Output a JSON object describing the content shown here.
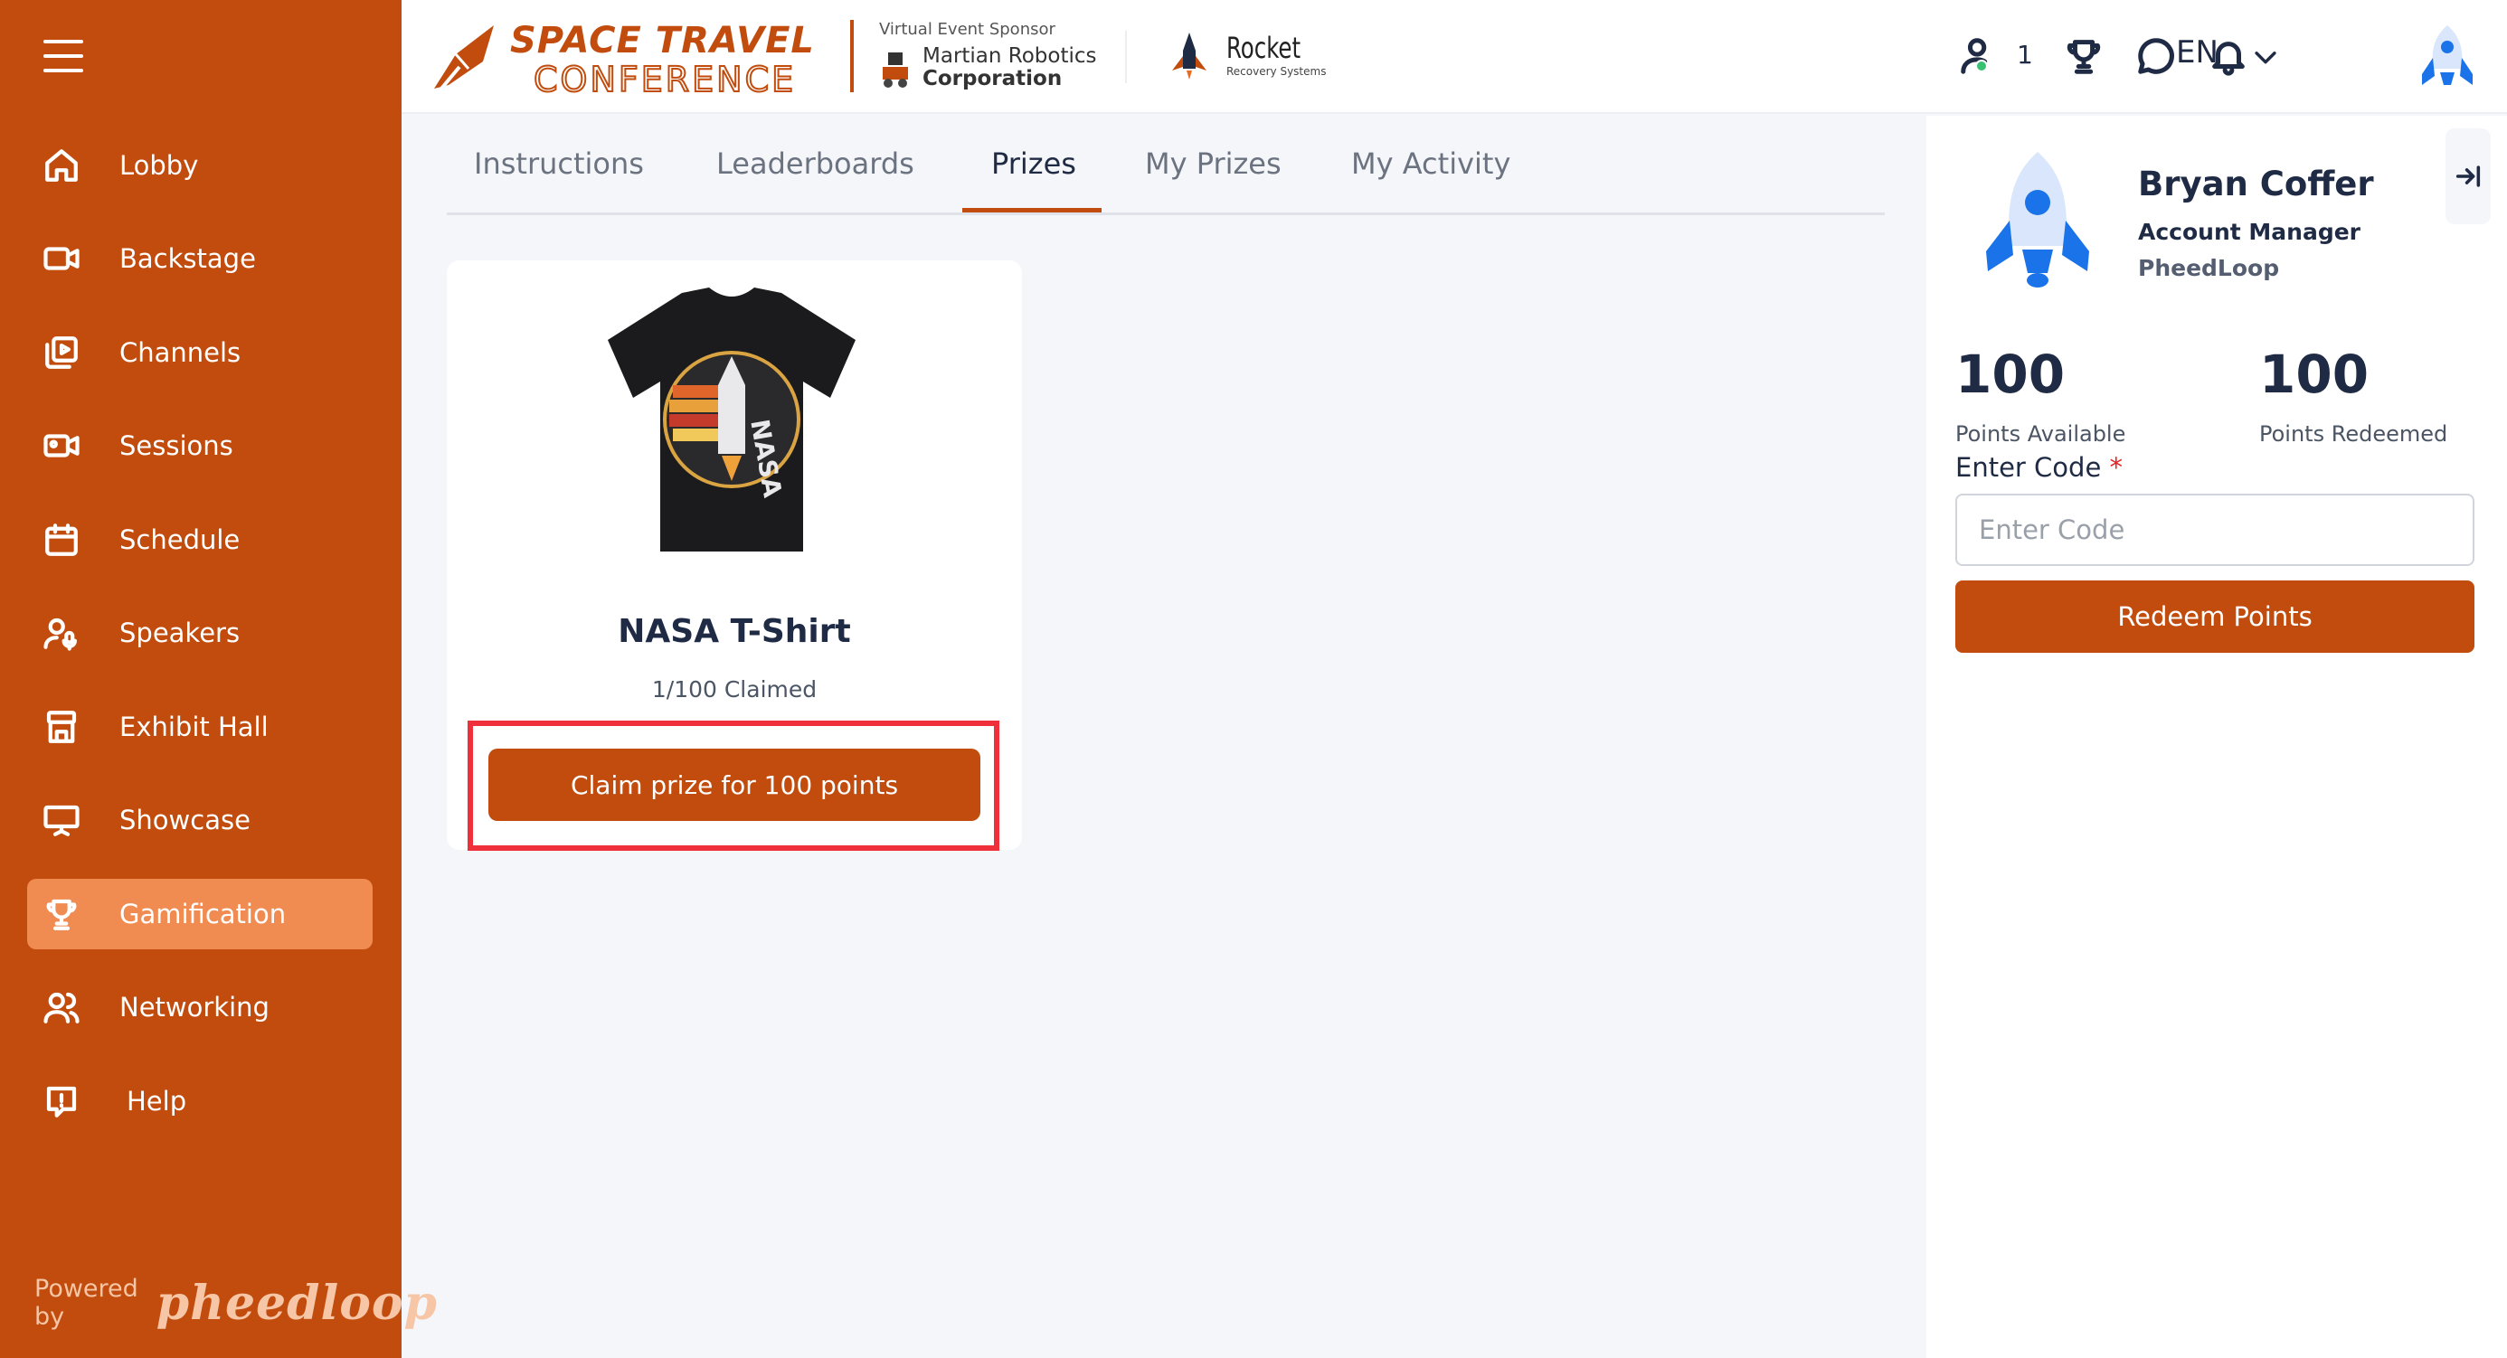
{
  "sidebar": {
    "items": [
      {
        "label": "Lobby",
        "icon": "home-icon"
      },
      {
        "label": "Backstage",
        "icon": "video-camera-icon"
      },
      {
        "label": "Channels",
        "icon": "channels-icon"
      },
      {
        "label": "Sessions",
        "icon": "video-camera-icon"
      },
      {
        "label": "Schedule",
        "icon": "calendar-icon"
      },
      {
        "label": "Speakers",
        "icon": "speaker-icon"
      },
      {
        "label": "Exhibit Hall",
        "icon": "booth-icon"
      },
      {
        "label": "Showcase",
        "icon": "presentation-icon"
      },
      {
        "label": "Gamification",
        "icon": "trophy-icon",
        "active": true
      },
      {
        "label": "Networking",
        "icon": "users-icon"
      },
      {
        "label": "Help",
        "icon": "help-icon"
      }
    ],
    "powered_by": "Powered by",
    "powered_brand": "pheedloop"
  },
  "header": {
    "logo_line1": "SPACE TRAVEL",
    "logo_line2": "CONFERENCE",
    "sponsor_title": "Virtual Event Sponsor",
    "sponsor_name_line1": "Martian Robotics",
    "sponsor_name_line2": "Corporation",
    "rocket_logo_title": "Rocket",
    "rocket_logo_sub": "Recovery Systems",
    "online_count": "1",
    "language": "EN"
  },
  "tabs": [
    {
      "label": "Instructions"
    },
    {
      "label": "Leaderboards"
    },
    {
      "label": "Prizes",
      "active": true
    },
    {
      "label": "My Prizes"
    },
    {
      "label": "My Activity"
    }
  ],
  "prize": {
    "name": "NASA T-Shirt",
    "claimed": "1/100 Claimed",
    "claim_button": "Claim prize for 100 points"
  },
  "profile": {
    "name": "Bryan Coffer",
    "title": "Account Manager",
    "organization": "PheedLoop",
    "points_available": "100",
    "points_available_label": "Points Available",
    "points_redeemed": "100",
    "points_redeemed_label": "Points Redeemed",
    "enter_code_label": "Enter Code",
    "required_mark": "*",
    "code_placeholder": "Enter Code",
    "redeem_button": "Redeem Points"
  },
  "colors": {
    "brand": "#c14c0d",
    "active_nav": "#f08c52",
    "highlight": "#ef2f3a"
  }
}
